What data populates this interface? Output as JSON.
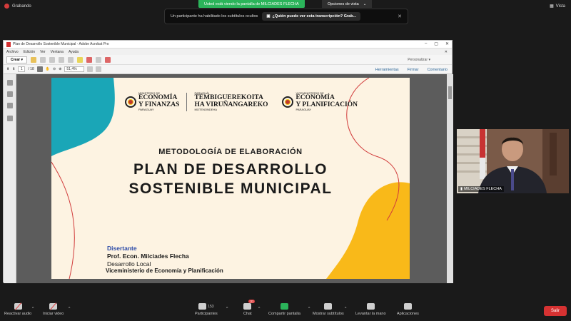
{
  "meeting": {
    "recording_label": "Grabando",
    "viewing_text": "Usted está viendo la pantalla de MILCIADES FLECHA",
    "view_options_label": "Opciones de vista",
    "view_label": "Vista",
    "notification_text": "Un participante ha habilitado los subtítulos ocultos",
    "notification_question": "¿Quién puede ver esta transcripción? Grab...",
    "participant_name": "MILCIADES FLECHA",
    "participant_count": "153",
    "chat_badge": "31"
  },
  "acrobat": {
    "window_title": "Plan de Desarrollo Sostenible Municipal - Adobe Acrobat Pro",
    "menus": [
      "Archivo",
      "Edición",
      "Ver",
      "Ventana",
      "Ayuda"
    ],
    "create_label": "Crear",
    "customize_label": "Personalizar",
    "page_current": "1",
    "page_total": "/ 18",
    "zoom": "51,4%",
    "right_links": [
      "Herramientas",
      "Firmar",
      "Comentario"
    ]
  },
  "slide": {
    "logo1_small_top": "MINISTERIO DE",
    "logo1_big1": "ECONOMÍA",
    "logo1_big2": "Y FINANZAS",
    "logo1_small_bottom": "PARAGUAY",
    "logo2_small_top": "PARAGUÁI",
    "logo2_big1": "TEMBIGUEREKOITA",
    "logo2_big2": "HA VIRUÑANGAREKO",
    "logo2_small_bottom": "MOTENONDEHA",
    "logo3_small_top": "VICEMINISTERIO DE",
    "logo3_big1": "ECONOMÍA",
    "logo3_big2": "Y PLANIFICACIÓN",
    "logo3_small_bottom": "PARAGUAY",
    "subtitle": "METODOLOGÍA DE ELABORACIÓN",
    "title_line1": "PLAN DE DESARROLLO",
    "title_line2": "SOSTENIBLE MUNICIPAL",
    "disertante_label": "Disertante",
    "speaker": "Prof. Econ. Milciades Flecha",
    "department": "Desarrollo Local",
    "viceministry": "Viceministerio de Economía y Planificación",
    "colors": {
      "background": "#fdf3e2",
      "teal": "#1aa6b7",
      "yellow": "#f9b919",
      "accent_line": "#d13b3b",
      "disertante": "#2b4aa8"
    }
  },
  "toolbar": {
    "mic_label": "Reactivar audio",
    "video_label": "Iniciar video",
    "participants_label": "Participantes",
    "chat_label": "Chat",
    "share_label": "Compartir pantalla",
    "captions_label": "Mostrar subtítulos",
    "raise_hand_label": "Levantar la mano",
    "apps_label": "Aplicaciones",
    "leave_label": "Salir"
  },
  "icons": [
    "record-dot-icon",
    "vista-grid-icon",
    "captions-icon",
    "close-icon",
    "pdf-icon",
    "mic-muted-icon",
    "video-off-icon",
    "participants-icon",
    "chat-icon",
    "share-screen-icon",
    "cc-icon",
    "hand-icon",
    "apps-icon",
    "signal-icon"
  ]
}
